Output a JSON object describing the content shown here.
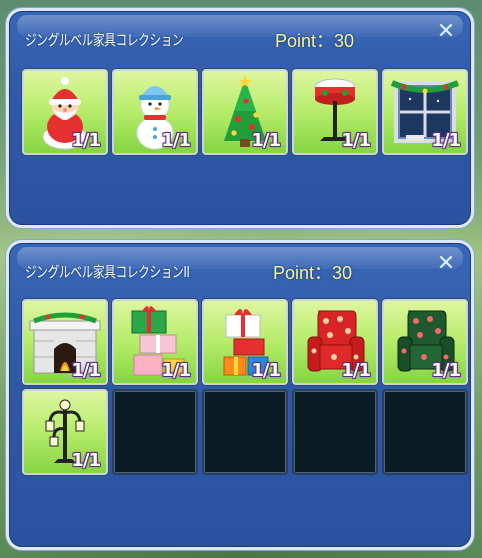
{
  "panels": [
    {
      "title": "ジングルベル家具コレクション",
      "points": "Point：30",
      "items": [
        {
          "name": "santa-claus-doll",
          "quantity": "1/1"
        },
        {
          "name": "snowman-doll",
          "quantity": "1/1"
        },
        {
          "name": "christmas-tree",
          "quantity": "1/1"
        },
        {
          "name": "christmas-lamp-stand",
          "quantity": "1/1"
        },
        {
          "name": "christmas-window",
          "quantity": "1/1"
        }
      ]
    },
    {
      "title": "ジングルベル家具コレクションII",
      "points": "Point：30",
      "items": [
        {
          "name": "fireplace",
          "quantity": "1/1"
        },
        {
          "name": "green-gift-stack",
          "quantity": "1/1"
        },
        {
          "name": "red-gift-stack",
          "quantity": "1/1"
        },
        {
          "name": "red-polka-dot-armchair",
          "quantity": "1/1"
        },
        {
          "name": "green-polka-dot-armchair",
          "quantity": "1/1"
        },
        {
          "name": "street-lamp",
          "quantity": "1/1"
        }
      ],
      "empty_slots": 4
    }
  ],
  "colors": {
    "panel": "#2f5aa8",
    "points_text": "#f4f39a",
    "slot_filled": "#b6ec6a",
    "slot_empty": "#0b1c24",
    "quantity_outline": "#5b2c7a"
  },
  "icons": {
    "close": "✕"
  }
}
